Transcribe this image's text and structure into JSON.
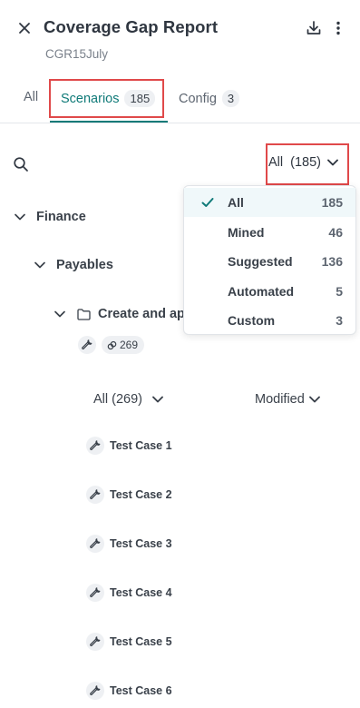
{
  "header": {
    "title": "Coverage Gap Report",
    "subtitle": "CGR15July"
  },
  "tabs": [
    {
      "label": "All",
      "count": null
    },
    {
      "label": "Scenarios",
      "count": "185"
    },
    {
      "label": "Config",
      "count": "3"
    }
  ],
  "filter": {
    "label": "All",
    "count": "(185)"
  },
  "tree": {
    "level1": "Finance",
    "level2": "Payables",
    "level3": "Create and ap",
    "link_count": "269"
  },
  "subfilters": {
    "left": "All (269)",
    "right": "Modified"
  },
  "dropdown": {
    "items": [
      {
        "label": "All",
        "count": "185",
        "selected": true
      },
      {
        "label": "Mined",
        "count": "46"
      },
      {
        "label": "Suggested",
        "count": "136"
      },
      {
        "label": "Automated",
        "count": "5"
      },
      {
        "label": "Custom",
        "count": "3"
      }
    ]
  },
  "test_cases": [
    "Test Case 1",
    "Test Case 2",
    "Test Case 3",
    "Test Case 4",
    "Test Case 5",
    "Test Case 6"
  ],
  "colors": {
    "accent": "#0f7a78",
    "highlight": "#e0494a",
    "text": "#2f3640",
    "muted": "#7a818b"
  },
  "icons": [
    "close-icon",
    "download-icon",
    "more-vertical-icon",
    "search-icon",
    "chevron-down-icon",
    "folder-icon",
    "wrench-icon",
    "link-icon",
    "check-icon"
  ]
}
